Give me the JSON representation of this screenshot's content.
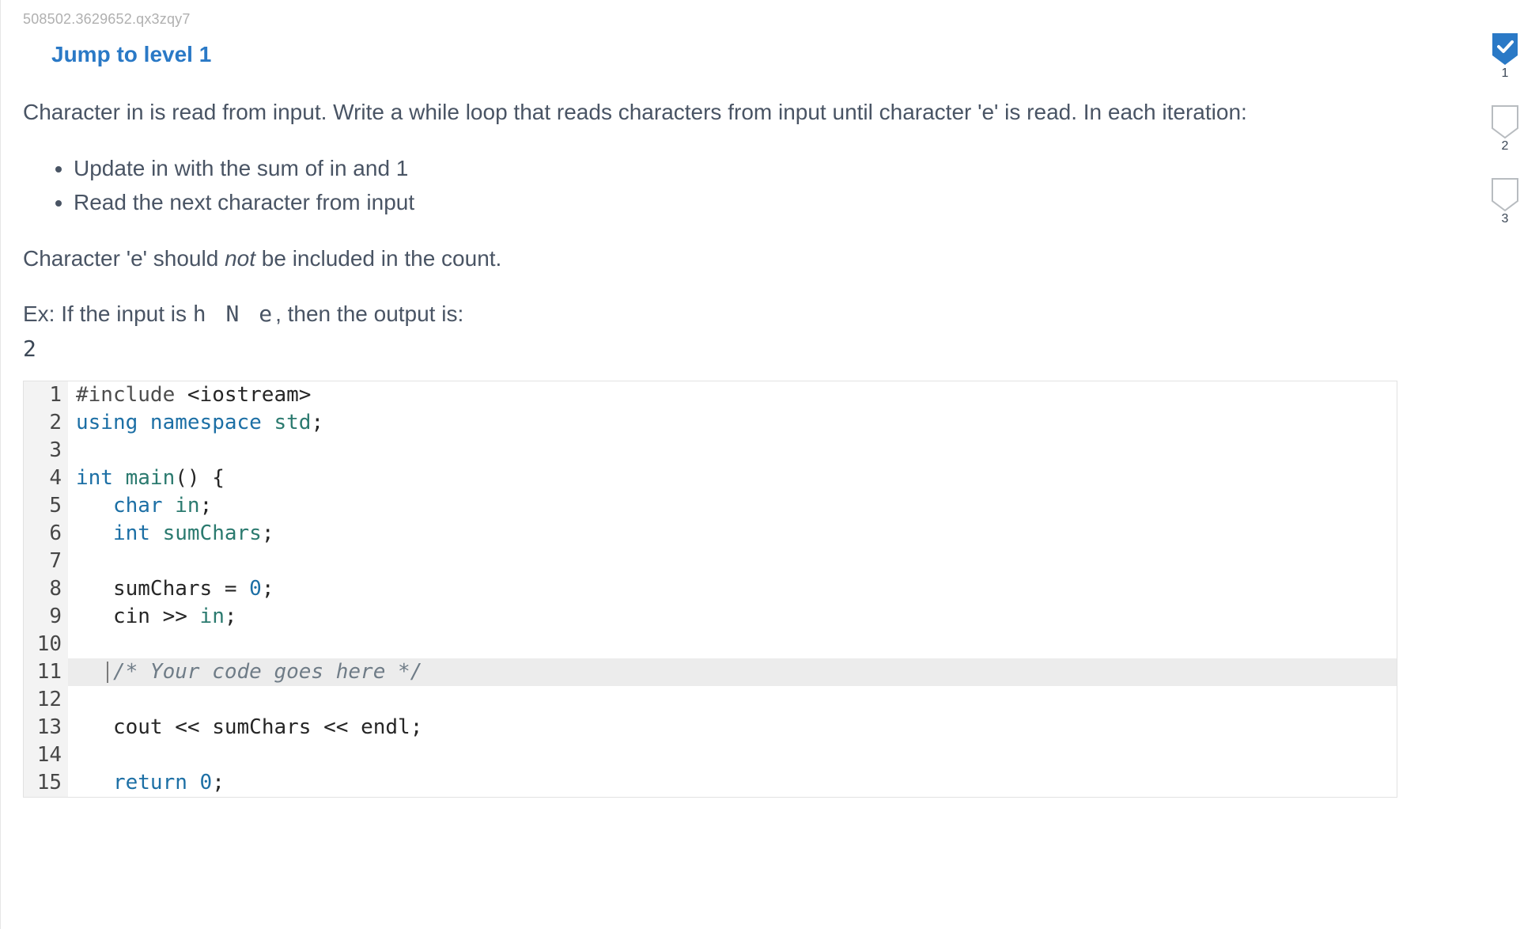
{
  "metaId": "508502.3629652.qx3zqy7",
  "jumpLink": "Jump to level 1",
  "intro": "Character in is read from input. Write a while loop that reads characters from input until character 'e' is read. In each iteration:",
  "bullets": [
    "Update in with the sum of in and 1",
    "Read the next character from input"
  ],
  "noteA": "Character 'e' should ",
  "noteEm": "not",
  "noteB": " be included in the count.",
  "exA": "Ex: If the input is ",
  "exInput": "h N e",
  "exB": ", then the output is:",
  "exOutput": "2",
  "levels": [
    {
      "n": "1",
      "done": true
    },
    {
      "n": "2",
      "done": false
    },
    {
      "n": "3",
      "done": false
    }
  ],
  "code": {
    "lines": [
      {
        "n": "1",
        "tokens": [
          [
            "pp",
            "#include "
          ],
          [
            "lt",
            "<iostream>"
          ]
        ]
      },
      {
        "n": "2",
        "tokens": [
          [
            "kw",
            "using "
          ],
          [
            "kw",
            "namespace "
          ],
          [
            "type",
            "std"
          ],
          [
            "punc",
            ";"
          ]
        ]
      },
      {
        "n": "3",
        "tokens": [
          [
            "id",
            ""
          ]
        ]
      },
      {
        "n": "4",
        "tokens": [
          [
            "kw",
            "int "
          ],
          [
            "type",
            "main"
          ],
          [
            "punc",
            "() {"
          ]
        ]
      },
      {
        "n": "5",
        "tokens": [
          [
            "id",
            "   "
          ],
          [
            "kw",
            "char "
          ],
          [
            "type",
            "in"
          ],
          [
            "punc",
            ";"
          ]
        ]
      },
      {
        "n": "6",
        "tokens": [
          [
            "id",
            "   "
          ],
          [
            "kw",
            "int "
          ],
          [
            "type",
            "sumChars"
          ],
          [
            "punc",
            ";"
          ]
        ]
      },
      {
        "n": "7",
        "tokens": [
          [
            "id",
            ""
          ]
        ]
      },
      {
        "n": "8",
        "tokens": [
          [
            "id",
            "   sumChars "
          ],
          [
            "punc",
            "= "
          ],
          [
            "num",
            "0"
          ],
          [
            "punc",
            ";"
          ]
        ]
      },
      {
        "n": "9",
        "tokens": [
          [
            "id",
            "   cin "
          ],
          [
            "punc",
            ">> "
          ],
          [
            "type",
            "in"
          ],
          [
            "punc",
            ";"
          ]
        ]
      },
      {
        "n": "10",
        "tokens": [
          [
            "id",
            ""
          ]
        ]
      },
      {
        "n": "11",
        "hl": true,
        "tokens": [
          [
            "id",
            "   "
          ],
          [
            "cmt",
            "/* Your code goes here */"
          ]
        ]
      },
      {
        "n": "12",
        "tokens": [
          [
            "id",
            ""
          ]
        ]
      },
      {
        "n": "13",
        "tokens": [
          [
            "id",
            "   cout "
          ],
          [
            "punc",
            "<< "
          ],
          [
            "id",
            "sumChars "
          ],
          [
            "punc",
            "<< "
          ],
          [
            "id",
            "endl"
          ],
          [
            "punc",
            ";"
          ]
        ]
      },
      {
        "n": "14",
        "tokens": [
          [
            "id",
            ""
          ]
        ]
      },
      {
        "n": "15",
        "tokens": [
          [
            "id",
            "   "
          ],
          [
            "kw",
            "return "
          ],
          [
            "num",
            "0"
          ],
          [
            "punc",
            ";"
          ]
        ]
      }
    ]
  }
}
